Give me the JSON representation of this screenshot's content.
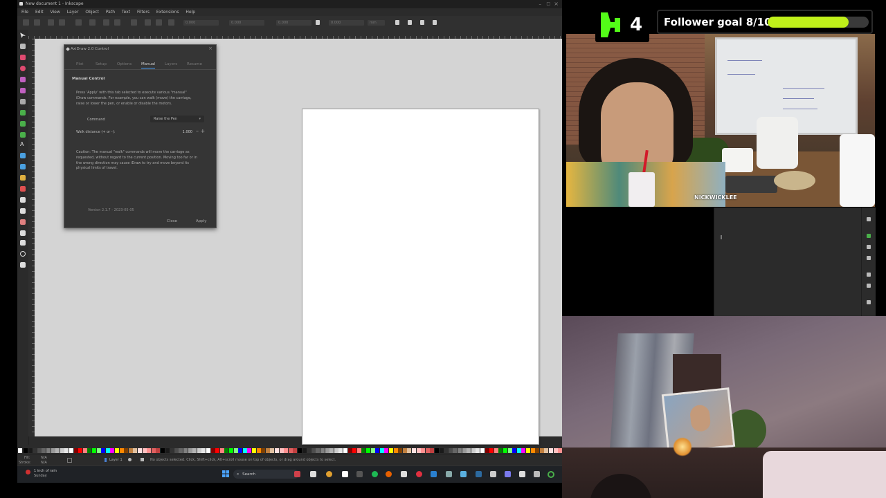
{
  "inkscape": {
    "title": "New document 1 - Inkscape",
    "menu": [
      "File",
      "Edit",
      "View",
      "Layer",
      "Object",
      "Path",
      "Text",
      "Filters",
      "Extensions",
      "Help"
    ],
    "fields": {
      "x": "0.000",
      "y": "0.000",
      "w": "0.000",
      "h": "0.000",
      "units": "mm"
    },
    "status": {
      "fill_label": "Fill:",
      "fill_value": "N/A",
      "stroke_label": "Stroke:",
      "stroke_value": "N/A",
      "layer": "Layer 1",
      "message": "No objects selected. Click, Shift+click, Alt+scroll mouse on top of objects, or drag around objects to select."
    }
  },
  "dialog": {
    "title": "AxiDraw 2.0 Control",
    "tabs": [
      "Plot",
      "Setup",
      "Options",
      "Manual",
      "Layers",
      "Resume"
    ],
    "active_tab": "Manual",
    "section_title": "Manual Control",
    "intro": "Press 'Apply' with this tab selected to execute various \"manual\" iDraw commands. For example, you can walk (move) the carriage, raise or lower the pen, or enable or disable the motors.",
    "command_label": "Command",
    "command_value": "Raise the Pen",
    "walk_label": "Walk distance (+ or -):",
    "walk_value": "1.000",
    "caution": "Caution: The manual \"walk\" commands will move the carriage as requested, without regard to the current position. Moving too far or in the wrong direction may cause iDraw to try and move beyond its physical limits of travel.",
    "version": "Version 2.1.7 - 2023-05-05",
    "close_label": "Close",
    "apply_label": "Apply"
  },
  "overlay": {
    "k_number": "4",
    "follower_goal": "Follower goal 8/10",
    "follower_progress": 0.8,
    "colors": {
      "kick_green": "#53fc18",
      "goal_bar": "#c0f01a"
    }
  },
  "webcam": {
    "name_tag": "NICKWICKLEE"
  },
  "taskbar": {
    "weather_line1": "1 inch of rain",
    "weather_line2": "Sunday",
    "search_placeholder": "Search"
  }
}
